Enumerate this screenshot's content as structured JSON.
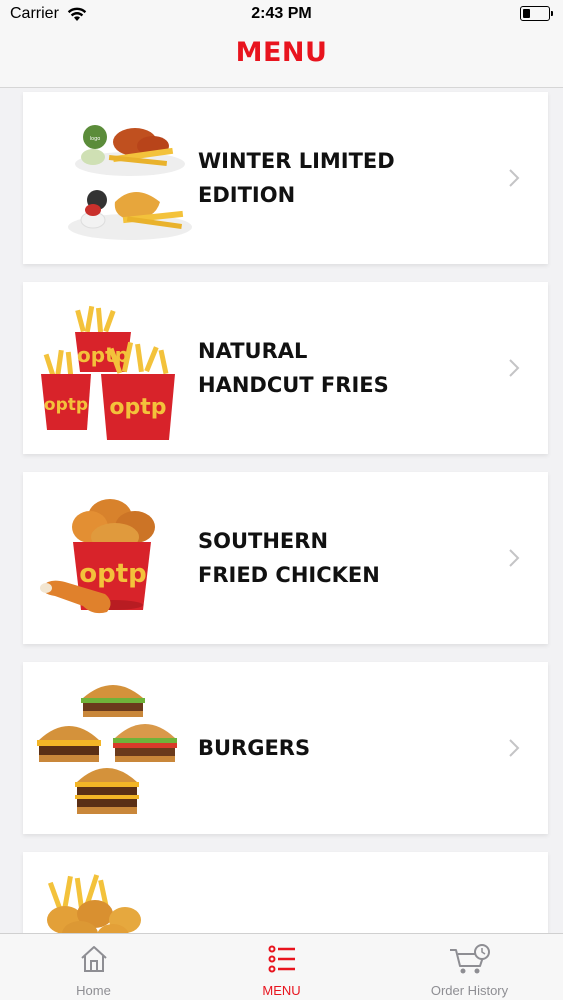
{
  "status_bar": {
    "carrier": "Carrier",
    "time": "2:43 PM",
    "battery_level_percent": 20
  },
  "header": {
    "title": "MENU",
    "title_color": "#e8141e"
  },
  "menu": {
    "items": [
      {
        "line1": "WINTER LIMITED EDITION",
        "line2": "",
        "image": "chicken-and-fish-platter-image"
      },
      {
        "line1": "NATURAL",
        "line2": "HANDCUT FRIES",
        "image": "fries-buckets-image"
      },
      {
        "line1": "SOUTHERN",
        "line2": "FRIED CHICKEN",
        "image": "fried-chicken-bucket-image"
      },
      {
        "line1": "BURGERS",
        "line2": "",
        "image": "burgers-image"
      },
      {
        "line1": "",
        "line2": "",
        "image": "nuggets-and-fries-image"
      }
    ]
  },
  "tab_bar": {
    "tabs": [
      {
        "label": "Home",
        "icon": "home-icon",
        "active": false
      },
      {
        "label": "MENU",
        "icon": "menu-list-icon",
        "active": true
      },
      {
        "label": "Order History",
        "icon": "cart-clock-icon",
        "active": false
      }
    ],
    "active_color": "#e8141e",
    "inactive_color": "#8e8e93"
  }
}
